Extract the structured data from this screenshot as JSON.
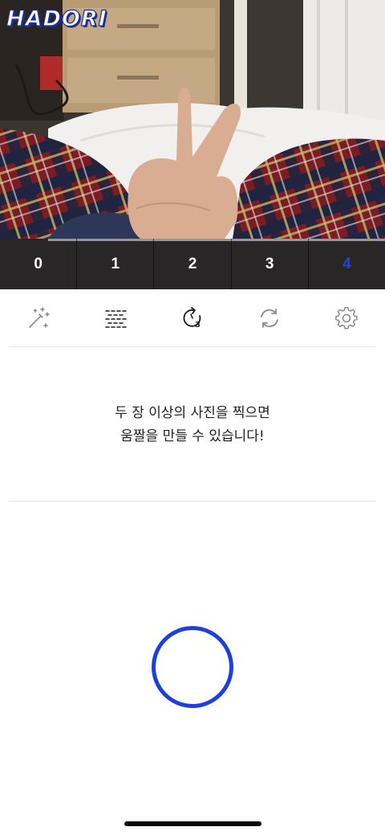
{
  "app": {
    "logo_text": "HADORI"
  },
  "frames": {
    "items": [
      "0",
      "1",
      "2",
      "3",
      "4"
    ],
    "selected_index": 4,
    "active_color": "#2443e0"
  },
  "toolbar": {
    "icons": [
      "magic-wand-icon",
      "texture-icon",
      "timer-3-icon",
      "switch-camera-icon",
      "settings-gear-icon"
    ],
    "timer_badge": "3"
  },
  "message": {
    "line1": "두 장 이상의 사진을 찍으면",
    "line2": "움짤을 만들 수 있습니다!"
  },
  "colors": {
    "accent": "#1e3fdc",
    "icon_gray": "#8a8a8a",
    "icon_dark": "#1a1a1a"
  }
}
